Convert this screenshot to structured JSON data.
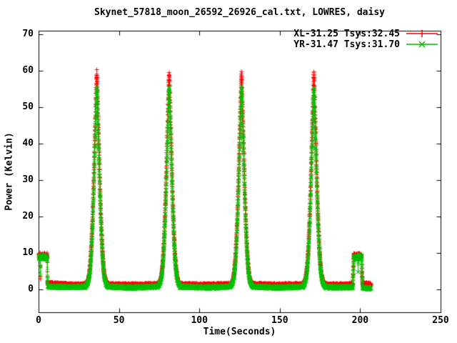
{
  "chart_data": {
    "type": "line",
    "style": "linespoints",
    "title": "Skynet_57818_moon_26592_26926_cal.txt, LOWRES, daisy",
    "xlabel": "Time(Seconds)",
    "ylabel": "Power (Kelvin)",
    "xlim": [
      0,
      250
    ],
    "ylim": [
      -6.27,
      71
    ],
    "xticks": [
      0,
      50,
      100,
      150,
      200,
      250
    ],
    "yticks": [
      0,
      10,
      20,
      30,
      40,
      50,
      60,
      70
    ],
    "grid": false,
    "legend_position": "top-right-inside",
    "background_color": "#ffffff",
    "axis_color": "#000000",
    "series": [
      {
        "name": "XL-31.25 Tsys:32.45",
        "color": "#ff0000",
        "marker": "plus",
        "baseline_K": 1.4,
        "peak_K": 59.5,
        "cal_plateau_K": 9.3,
        "envelope": [
          [
            0,
            9.3
          ],
          [
            0.8,
            9.3
          ],
          [
            0.9,
            2.0
          ],
          [
            1.0,
            9.3
          ],
          [
            5.2,
            9.3
          ],
          [
            5.35,
            2.2
          ],
          [
            5.6,
            1.7
          ],
          [
            20,
            1.35
          ],
          [
            36,
            1.5
          ],
          [
            58,
            1.3
          ],
          [
            81,
            1.5
          ],
          [
            103,
            1.3
          ],
          [
            126,
            1.5
          ],
          [
            148,
            1.3
          ],
          [
            171,
            1.5
          ],
          [
            185,
            1.35
          ],
          [
            195.2,
            1.45
          ],
          [
            195.45,
            5.0
          ],
          [
            195.8,
            9.3
          ],
          [
            200.7,
            9.3
          ],
          [
            200.9,
            5.0
          ],
          [
            201.3,
            1.6
          ],
          [
            206.5,
            1.45
          ]
        ]
      },
      {
        "name": "YR-31.47 Tsys:31.70",
        "color": "#00c000",
        "marker": "cross",
        "baseline_K": 0.7,
        "peak_K": 55.5,
        "cal_plateau_K": 8.9,
        "envelope": [
          [
            0,
            8.9
          ],
          [
            0.8,
            8.9
          ],
          [
            0.9,
            3.2
          ],
          [
            1.0,
            8.9
          ],
          [
            5.2,
            8.9
          ],
          [
            5.35,
            3.2
          ],
          [
            5.6,
            0.85
          ],
          [
            20,
            0.7
          ],
          [
            36,
            0.95
          ],
          [
            58,
            0.6
          ],
          [
            81,
            0.95
          ],
          [
            103,
            0.6
          ],
          [
            126,
            0.95
          ],
          [
            148,
            0.6
          ],
          [
            171,
            0.95
          ],
          [
            185,
            0.65
          ],
          [
            195.2,
            0.7
          ],
          [
            195.45,
            4.2
          ],
          [
            195.8,
            8.9
          ],
          [
            198.4,
            8.9
          ],
          [
            198.5,
            4.3
          ],
          [
            198.6,
            8.9
          ],
          [
            200.7,
            8.9
          ],
          [
            200.9,
            4.2
          ],
          [
            201.3,
            0.5
          ],
          [
            206.5,
            0.4
          ]
        ]
      }
    ],
    "peaks": {
      "centers_s": [
        36,
        81,
        126,
        171
      ],
      "base_halfwidth_s": 7,
      "shape": [
        [
          -7,
          0
        ],
        [
          -6.5,
          0.005
        ],
        [
          -6,
          0.012
        ],
        [
          -5.5,
          0.02
        ],
        [
          -5,
          0.035
        ],
        [
          -4.5,
          0.06
        ],
        [
          -4,
          0.1
        ],
        [
          -3.5,
          0.16
        ],
        [
          -3,
          0.24
        ],
        [
          -2.5,
          0.34
        ],
        [
          -2,
          0.46
        ],
        [
          -1.75,
          0.53
        ],
        [
          -1.5,
          0.6
        ],
        [
          -1.25,
          0.67
        ],
        [
          -1,
          0.74
        ],
        [
          -0.75,
          0.81
        ],
        [
          -0.5,
          0.88
        ],
        [
          -0.25,
          0.95
        ],
        [
          0,
          1.0
        ],
        [
          0.25,
          0.95
        ],
        [
          0.5,
          0.88
        ],
        [
          0.75,
          0.81
        ],
        [
          1,
          0.74
        ],
        [
          1.25,
          0.67
        ],
        [
          1.5,
          0.6
        ],
        [
          1.75,
          0.53
        ],
        [
          2,
          0.46
        ],
        [
          2.5,
          0.34
        ],
        [
          3,
          0.24
        ],
        [
          3.5,
          0.16
        ],
        [
          4,
          0.1
        ],
        [
          4.5,
          0.06
        ],
        [
          5,
          0.035
        ],
        [
          5.5,
          0.02
        ],
        [
          6,
          0.012
        ],
        [
          6.5,
          0.005
        ],
        [
          7,
          0
        ]
      ]
    },
    "sampling": {
      "t_start": 0,
      "t_end": 206.5,
      "interval_s": 0.04,
      "noise_K_baseline": 0.26,
      "noise_K_high": 0.45
    }
  }
}
